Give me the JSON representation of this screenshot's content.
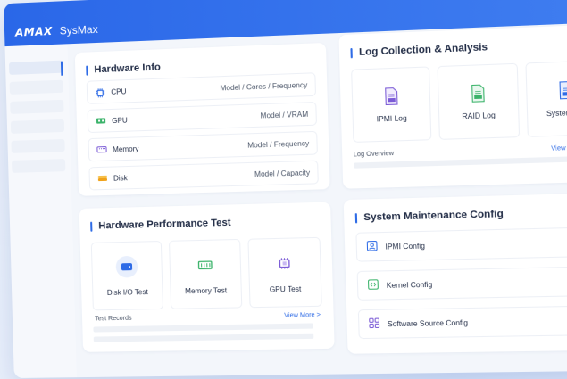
{
  "app": {
    "logo": "AMAX",
    "title": "SysMax"
  },
  "hardware_info": {
    "title": "Hardware Info",
    "rows": [
      {
        "label": "CPU",
        "detail": "Model / Cores / Frequency",
        "icon": "cpu-icon"
      },
      {
        "label": "GPU",
        "detail": "Model / VRAM",
        "icon": "gpu-icon"
      },
      {
        "label": "Memory",
        "detail": "Model / Frequency",
        "icon": "memory-icon"
      },
      {
        "label": "Disk",
        "detail": "Model / Capacity",
        "icon": "disk-icon"
      }
    ]
  },
  "perf_test": {
    "title": "Hardware Performance Test",
    "tiles": [
      {
        "label": "Disk I/O Test",
        "icon": "disk-icon"
      },
      {
        "label": "Memory Test",
        "icon": "memory-icon"
      },
      {
        "label": "GPU Test",
        "icon": "gpu-icon"
      }
    ],
    "records_label": "Test Records",
    "view_more": "View More >"
  },
  "logs": {
    "title": "Log Collection & Analysis",
    "tiles": [
      {
        "label": "IPMI Log",
        "icon": "ipmi-doc-icon",
        "tag": "IPMI"
      },
      {
        "label": "RAID Log",
        "icon": "raid-doc-icon",
        "tag": "RAID"
      },
      {
        "label": "System Log",
        "icon": "system-doc-icon",
        "tag": "System"
      }
    ],
    "overview_label": "Log Overview",
    "view_more": "View More >"
  },
  "maintenance": {
    "title": "System Maintenance Config",
    "rows": [
      {
        "label": "IPMI Config",
        "icon": "ipmi-config-icon"
      },
      {
        "label": "Kernel Config",
        "icon": "kernel-icon"
      },
      {
        "label": "Software Source Config",
        "icon": "grid-icon"
      }
    ]
  },
  "colors": {
    "accent": "#2e6be6",
    "topbar": "#2a67e8",
    "gpu_green": "#3bb36a",
    "disk_amber": "#f0a21a",
    "memory_purple": "#7b5bd6"
  }
}
